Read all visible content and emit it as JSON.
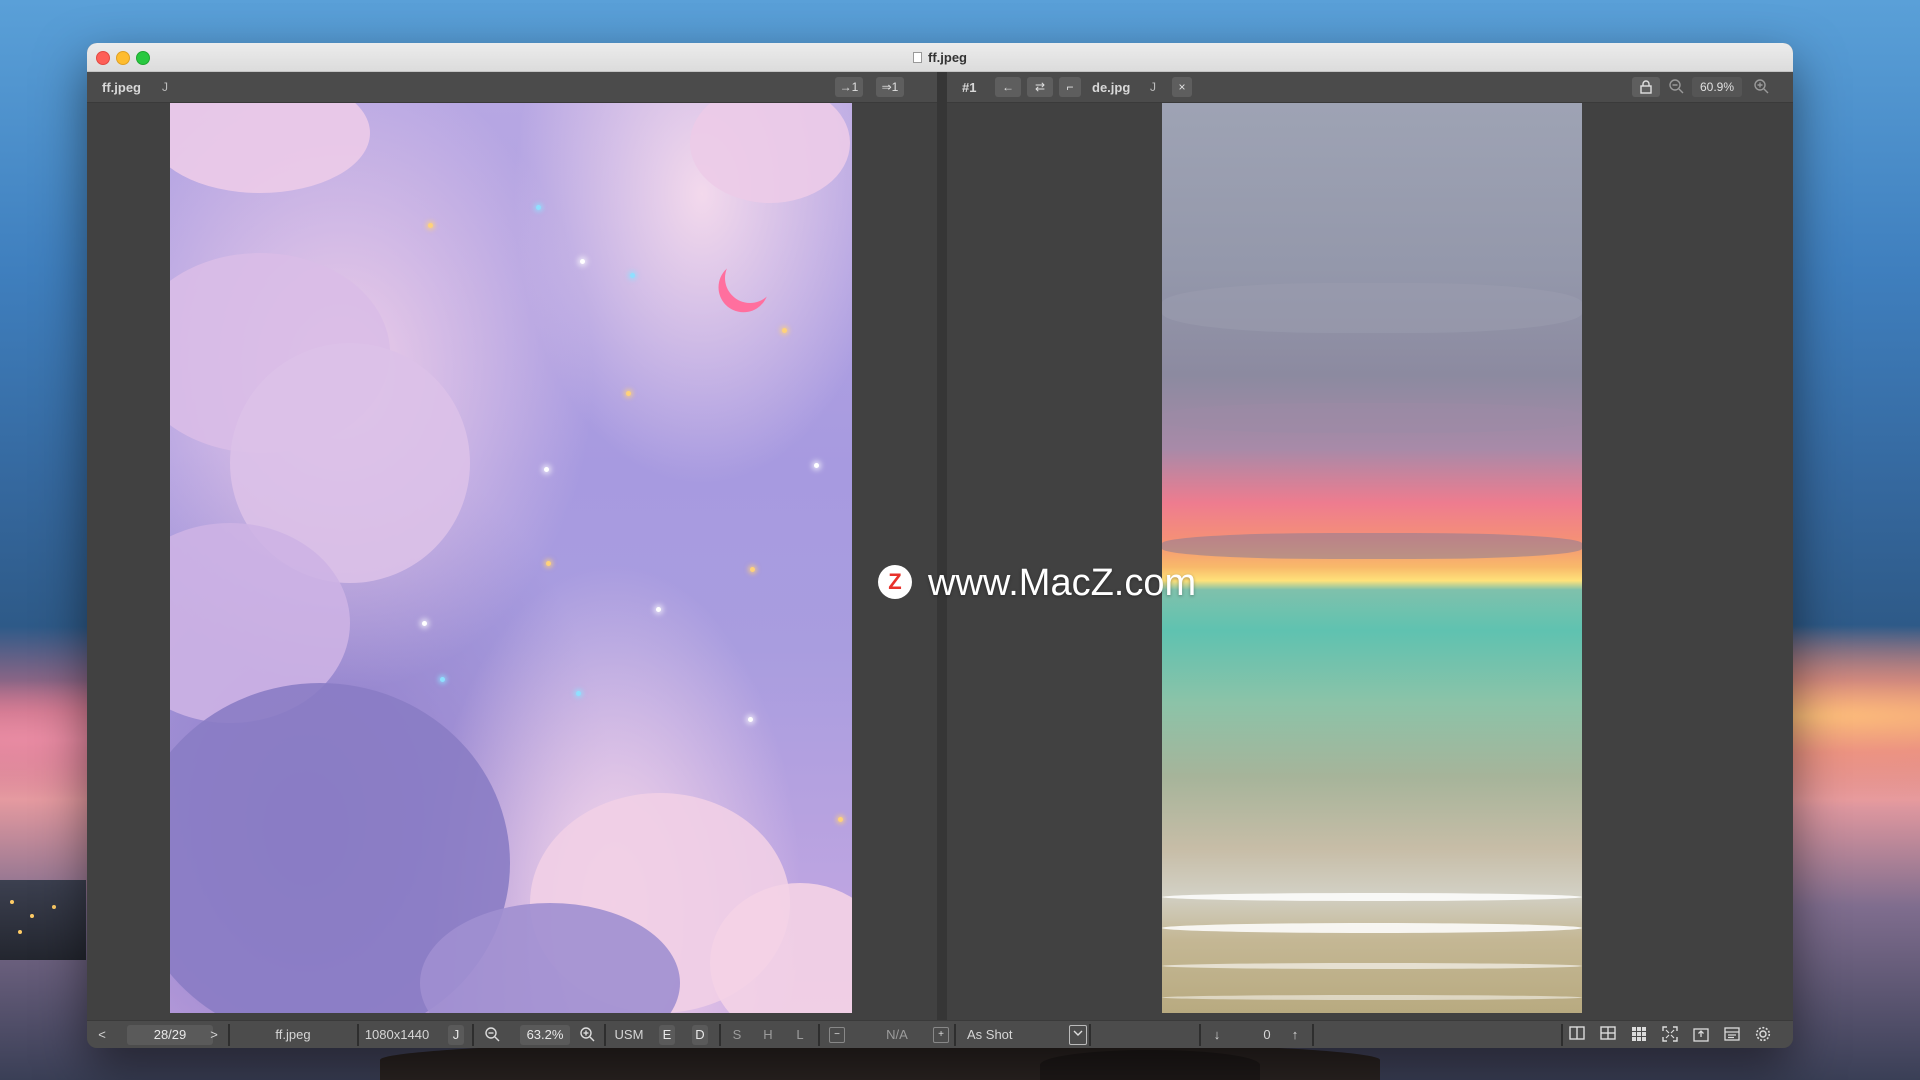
{
  "window": {
    "title": "ff.jpeg"
  },
  "left_panel": {
    "filename": "ff.jpeg",
    "j_label": "J",
    "btn_sync_a": "→1",
    "btn_sync_b": "⇒1"
  },
  "right_panel": {
    "index_label": "#1",
    "prev_label": "←",
    "swap_label": "⇄",
    "corner_label": "⌐",
    "filename": "de.jpg",
    "j_label": "J",
    "close_label": "×",
    "zoom": "60.9%"
  },
  "watermark": {
    "logo_letter": "Z",
    "text": "www.MacZ.com"
  },
  "statusbar": {
    "prev_label": "<",
    "page_counter": "28/29",
    "next_label": ">",
    "filename": "ff.jpeg",
    "dimensions": "1080x1440",
    "j_label": "J",
    "zoom": "63.2%",
    "usm_label": "USM",
    "e_label": "E",
    "d_label": "D",
    "s_label": "S",
    "h_label": "H",
    "l_label": "L",
    "minus_label": "−",
    "na_value": "N/A",
    "plus_label": "+",
    "white_balance": "As Shot",
    "down_arrow": "↓",
    "exposure_value": "0",
    "up_arrow": "↑"
  },
  "colors": {
    "window_bg": "#424242",
    "toolbar_bg": "#4b4b4b",
    "statusbar_bg": "#4c4c4c",
    "accent_red": "#fe5f57",
    "accent_yellow": "#febc2e",
    "accent_green": "#28c840"
  },
  "icons": [
    "lock-icon",
    "zoom-out-icon",
    "zoom-in-icon",
    "single-view-icon",
    "grid-2x2-icon",
    "grid-3x3-icon",
    "fullscreen-icon",
    "export-icon",
    "image-info-icon",
    "settings-icon"
  ]
}
